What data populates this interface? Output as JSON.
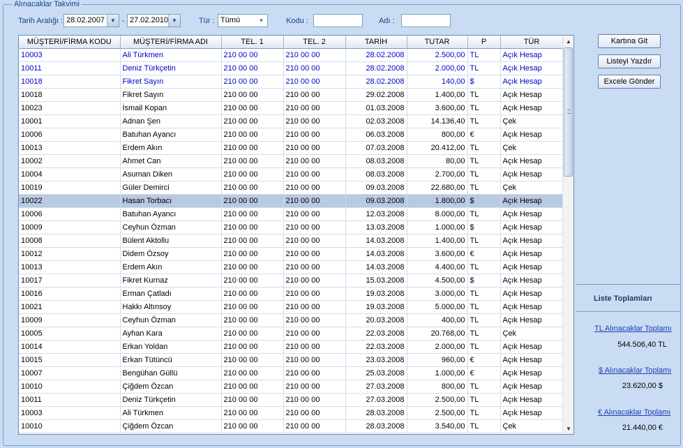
{
  "group": {
    "title": "Alınacaklar Takvimi"
  },
  "filters": {
    "date_range_label": "Tarih Aralığı :",
    "date_from": "28.02.2007",
    "date_sep": "-",
    "date_to": "27.02.2010",
    "type_label": "Tür :",
    "type_value": "Tümü",
    "code_label": "Kodu :",
    "code_value": "",
    "name_label": "Adı :",
    "name_value": ""
  },
  "table": {
    "columns": [
      "MÜŞTERİ/FİRMA KODU",
      "MÜŞTERİ/FİRMA ADI",
      "TEL. 1",
      "TEL. 2",
      "TARİH",
      "TUTAR",
      "P",
      "TÜR"
    ],
    "rows": [
      {
        "code": "10003",
        "name": "Ali Türkmen",
        "tel1": "210 00 00",
        "tel2": "210 00 00",
        "date": "28.02.2008",
        "amount": "2.500,00",
        "cur": "TL",
        "type": "Açık Hesap",
        "style": "blue"
      },
      {
        "code": "10011",
        "name": "Deniz Türkçetin",
        "tel1": "210 00 00",
        "tel2": "210 00 00",
        "date": "28.02.2008",
        "amount": "2.000,00",
        "cur": "TL",
        "type": "Açık Hesap",
        "style": "blue"
      },
      {
        "code": "10018",
        "name": "Fikret Sayın",
        "tel1": "210 00 00",
        "tel2": "210 00 00",
        "date": "28.02.2008",
        "amount": "140,00",
        "cur": "$",
        "type": "Açık Hesap",
        "style": "blue"
      },
      {
        "code": "10018",
        "name": "Fikret Sayın",
        "tel1": "210 00 00",
        "tel2": "210 00 00",
        "date": "29.02.2008",
        "amount": "1.400,00",
        "cur": "TL",
        "type": "Açık Hesap",
        "style": ""
      },
      {
        "code": "10023",
        "name": "İsmail Kopan",
        "tel1": "210 00 00",
        "tel2": "210 00 00",
        "date": "01.03.2008",
        "amount": "3.600,00",
        "cur": "TL",
        "type": "Açık Hesap",
        "style": ""
      },
      {
        "code": "10001",
        "name": "Adnan Şen",
        "tel1": "210 00 00",
        "tel2": "210 00 00",
        "date": "02.03.2008",
        "amount": "14.136,40",
        "cur": "TL",
        "type": "Çek",
        "style": ""
      },
      {
        "code": "10006",
        "name": "Batuhan Ayancı",
        "tel1": "210 00 00",
        "tel2": "210 00 00",
        "date": "06.03.2008",
        "amount": "800,00",
        "cur": "€",
        "type": "Açık Hesap",
        "style": ""
      },
      {
        "code": "10013",
        "name": "Erdem Akın",
        "tel1": "210 00 00",
        "tel2": "210 00 00",
        "date": "07.03.2008",
        "amount": "20.412,00",
        "cur": "TL",
        "type": "Çek",
        "style": ""
      },
      {
        "code": "10002",
        "name": "Ahmet Can",
        "tel1": "210 00 00",
        "tel2": "210 00 00",
        "date": "08.03.2008",
        "amount": "80,00",
        "cur": "TL",
        "type": "Açık Hesap",
        "style": ""
      },
      {
        "code": "10004",
        "name": "Asuman Diken",
        "tel1": "210 00 00",
        "tel2": "210 00 00",
        "date": "08.03.2008",
        "amount": "2.700,00",
        "cur": "TL",
        "type": "Açık Hesap",
        "style": ""
      },
      {
        "code": "10019",
        "name": "Güler Demirci",
        "tel1": "210 00 00",
        "tel2": "210 00 00",
        "date": "09.03.2008",
        "amount": "22.680,00",
        "cur": "TL",
        "type": "Çek",
        "style": ""
      },
      {
        "code": "10022",
        "name": "Hasan Torbacı",
        "tel1": "210 00 00",
        "tel2": "210 00 00",
        "date": "09.03.2008",
        "amount": "1.800,00",
        "cur": "$",
        "type": "Açık Hesap",
        "style": "selected"
      },
      {
        "code": "10006",
        "name": "Batuhan Ayancı",
        "tel1": "210 00 00",
        "tel2": "210 00 00",
        "date": "12.03.2008",
        "amount": "8.000,00",
        "cur": "TL",
        "type": "Açık Hesap",
        "style": ""
      },
      {
        "code": "10009",
        "name": "Ceyhun Özman",
        "tel1": "210 00 00",
        "tel2": "210 00 00",
        "date": "13.03.2008",
        "amount": "1.000,00",
        "cur": "$",
        "type": "Açık Hesap",
        "style": ""
      },
      {
        "code": "10008",
        "name": "Bülent Aktollu",
        "tel1": "210 00 00",
        "tel2": "210 00 00",
        "date": "14.03.2008",
        "amount": "1.400,00",
        "cur": "TL",
        "type": "Açık Hesap",
        "style": ""
      },
      {
        "code": "10012",
        "name": "Didem Özsoy",
        "tel1": "210 00 00",
        "tel2": "210 00 00",
        "date": "14.03.2008",
        "amount": "3.600,00",
        "cur": "€",
        "type": "Açık Hesap",
        "style": ""
      },
      {
        "code": "10013",
        "name": "Erdem Akın",
        "tel1": "210 00 00",
        "tel2": "210 00 00",
        "date": "14.03.2008",
        "amount": "4.400,00",
        "cur": "TL",
        "type": "Açık Hesap",
        "style": ""
      },
      {
        "code": "10017",
        "name": "Fikret Kurnaz",
        "tel1": "210 00 00",
        "tel2": "210 00 00",
        "date": "15.03.2008",
        "amount": "4.500,00",
        "cur": "$",
        "type": "Açık Hesap",
        "style": ""
      },
      {
        "code": "10016",
        "name": "Erman Çatladı",
        "tel1": "210 00 00",
        "tel2": "210 00 00",
        "date": "19.03.2008",
        "amount": "3.000,00",
        "cur": "TL",
        "type": "Açık Hesap",
        "style": ""
      },
      {
        "code": "10021",
        "name": "Hakkı Altınsoy",
        "tel1": "210 00 00",
        "tel2": "210 00 00",
        "date": "19.03.2008",
        "amount": "5.000,00",
        "cur": "TL",
        "type": "Açık Hesap",
        "style": ""
      },
      {
        "code": "10009",
        "name": "Ceyhun Özman",
        "tel1": "210 00 00",
        "tel2": "210 00 00",
        "date": "20.03.2008",
        "amount": "400,00",
        "cur": "TL",
        "type": "Açık Hesap",
        "style": ""
      },
      {
        "code": "10005",
        "name": "Ayhan Kara",
        "tel1": "210 00 00",
        "tel2": "210 00 00",
        "date": "22.03.2008",
        "amount": "20.768,00",
        "cur": "TL",
        "type": "Çek",
        "style": ""
      },
      {
        "code": "10014",
        "name": "Erkan Yoldan",
        "tel1": "210 00 00",
        "tel2": "210 00 00",
        "date": "22.03.2008",
        "amount": "2.000,00",
        "cur": "TL",
        "type": "Açık Hesap",
        "style": ""
      },
      {
        "code": "10015",
        "name": "Erkan Tütüncü",
        "tel1": "210 00 00",
        "tel2": "210 00 00",
        "date": "23.03.2008",
        "amount": "960,00",
        "cur": "€",
        "type": "Açık Hesap",
        "style": ""
      },
      {
        "code": "10007",
        "name": "Bengühan Güllü",
        "tel1": "210 00 00",
        "tel2": "210 00 00",
        "date": "25.03.2008",
        "amount": "1.000,00",
        "cur": "€",
        "type": "Açık Hesap",
        "style": ""
      },
      {
        "code": "10010",
        "name": "Çiğdem Özcan",
        "tel1": "210 00 00",
        "tel2": "210 00 00",
        "date": "27.03.2008",
        "amount": "800,00",
        "cur": "TL",
        "type": "Açık Hesap",
        "style": ""
      },
      {
        "code": "10011",
        "name": "Deniz Türkçetin",
        "tel1": "210 00 00",
        "tel2": "210 00 00",
        "date": "27.03.2008",
        "amount": "2.500,00",
        "cur": "TL",
        "type": "Açık Hesap",
        "style": ""
      },
      {
        "code": "10003",
        "name": "Ali Türkmen",
        "tel1": "210 00 00",
        "tel2": "210 00 00",
        "date": "28.03.2008",
        "amount": "2.500,00",
        "cur": "TL",
        "type": "Açık Hesap",
        "style": ""
      },
      {
        "code": "10010",
        "name": "Çiğdem Özcan",
        "tel1": "210 00 00",
        "tel2": "210 00 00",
        "date": "28.03.2008",
        "amount": "3.540,00",
        "cur": "TL",
        "type": "Çek",
        "style": ""
      }
    ]
  },
  "side": {
    "btn_card": "Kartına Git",
    "btn_print": "Listeyi Yazdır",
    "btn_excel": "Excele Gönder",
    "totals_title": "Liste Toplamları",
    "tl_label": "TL  Alınacaklar Toplamı",
    "tl_value": "544.506,40 TL",
    "usd_label": "$  Alınacaklar Toplamı",
    "usd_value": "23.620,00 $",
    "eur_label": "€  Alınacaklar Toplamı",
    "eur_value": "21.440,00 €"
  },
  "colors": {
    "background": "#c9dcf3",
    "link": "#1e3cb4",
    "highlight_text": "#0000c8",
    "selected_row": "#b8c9e2"
  }
}
